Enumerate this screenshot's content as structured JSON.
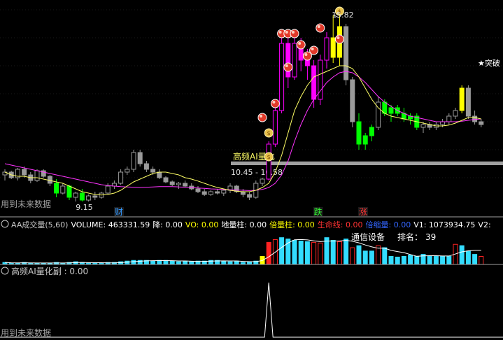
{
  "colors": {
    "bg": "#000000",
    "up": "#ff00ff",
    "down": "#00ff00",
    "neutral": "#9a9a9a",
    "signal": "#ffff00",
    "ma_fast": "#ffff66",
    "ma_slow": "#ff33ff",
    "vol_up": "#ff2222",
    "vol_down": "#33ddff",
    "text": "#c8c8c8",
    "sep": "#a0a0a0"
  },
  "main": {
    "annotation_high": "15.82",
    "annotation_low": "9.15",
    "breakout_label": "★突破",
    "band_title": "高频AI量化",
    "band_range": "10.45 - 10.58",
    "watermark": "用到未来数据",
    "markers": [
      {
        "text": "财",
        "color": "#3399ff"
      },
      {
        "text": "跌",
        "color": "#33ff33"
      },
      {
        "text": "涨",
        "color": "#ff3333"
      }
    ],
    "icons": [
      "money-bag-icon",
      "ball-icon"
    ]
  },
  "vol_panel": {
    "header": [
      {
        "text": "AA成交量(5,60)",
        "color": "#c8c8c8"
      },
      {
        "text": "VOLUME: 463331.59",
        "color": "#ffffff"
      },
      {
        "text": "降: 0.00",
        "color": "#ffffff"
      },
      {
        "text": "VO: 0.00",
        "color": "#ffff00"
      },
      {
        "text": "地量柱: 0.00",
        "color": "#ffffff"
      },
      {
        "text": "倍量柱: 0.00",
        "color": "#ffff00"
      },
      {
        "text": "生命线: 0.00",
        "color": "#ff3333"
      },
      {
        "text": "倍缩量: 0.00",
        "color": "#3366ff"
      },
      {
        "text": "V1: 1073934.75",
        "color": "#ffffff"
      },
      {
        "text": "V2:",
        "color": "#ffffff"
      }
    ],
    "sector": "通信设备",
    "rank_label": "排名：",
    "rank": "39"
  },
  "ai_panel": {
    "header": "高频AI量化副 : 0.00",
    "watermark": "用到未来数据"
  },
  "chart_data": {
    "type": "candlestick",
    "ylim": [
      8.8,
      16.2
    ],
    "band": [
      10.45,
      10.58
    ],
    "high_marker": 15.82,
    "low_marker": 9.15,
    "candles": [
      {
        "o": 10.1,
        "h": 10.3,
        "l": 9.9,
        "c": 10.2,
        "t": "n"
      },
      {
        "o": 10.2,
        "h": 10.25,
        "l": 9.95,
        "c": 10.0,
        "t": "n"
      },
      {
        "o": 10.0,
        "h": 10.35,
        "l": 9.9,
        "c": 10.3,
        "t": "n"
      },
      {
        "o": 10.3,
        "h": 10.4,
        "l": 10.0,
        "c": 10.1,
        "t": "n"
      },
      {
        "o": 10.1,
        "h": 10.2,
        "l": 9.8,
        "c": 9.9,
        "t": "n"
      },
      {
        "o": 9.9,
        "h": 10.3,
        "l": 9.85,
        "c": 10.25,
        "t": "n"
      },
      {
        "o": 10.25,
        "h": 10.3,
        "l": 10.0,
        "c": 10.05,
        "t": "n"
      },
      {
        "o": 10.05,
        "h": 10.1,
        "l": 9.7,
        "c": 9.8,
        "t": "n"
      },
      {
        "o": 9.8,
        "h": 9.95,
        "l": 9.3,
        "c": 9.45,
        "t": "d"
      },
      {
        "o": 9.45,
        "h": 9.8,
        "l": 9.4,
        "c": 9.7,
        "t": "n"
      },
      {
        "o": 9.7,
        "h": 9.75,
        "l": 9.2,
        "c": 9.3,
        "t": "d"
      },
      {
        "o": 9.3,
        "h": 9.5,
        "l": 9.15,
        "c": 9.45,
        "t": "n"
      },
      {
        "o": 9.45,
        "h": 9.6,
        "l": 9.15,
        "c": 9.2,
        "t": "d"
      },
      {
        "o": 9.2,
        "h": 9.4,
        "l": 9.15,
        "c": 9.35,
        "t": "n"
      },
      {
        "o": 9.35,
        "h": 9.5,
        "l": 9.2,
        "c": 9.3,
        "t": "n"
      },
      {
        "o": 9.3,
        "h": 9.5,
        "l": 9.25,
        "c": 9.45,
        "t": "n"
      },
      {
        "o": 9.45,
        "h": 9.8,
        "l": 9.4,
        "c": 9.7,
        "t": "n"
      },
      {
        "o": 9.7,
        "h": 9.9,
        "l": 9.6,
        "c": 9.8,
        "t": "n"
      },
      {
        "o": 9.8,
        "h": 10.3,
        "l": 9.75,
        "c": 10.2,
        "t": "n"
      },
      {
        "o": 10.2,
        "h": 10.4,
        "l": 10.1,
        "c": 10.3,
        "t": "n"
      },
      {
        "o": 10.3,
        "h": 11.0,
        "l": 10.2,
        "c": 10.9,
        "t": "n"
      },
      {
        "o": 10.9,
        "h": 11.0,
        "l": 10.4,
        "c": 10.5,
        "t": "n"
      },
      {
        "o": 10.5,
        "h": 10.6,
        "l": 10.2,
        "c": 10.3,
        "t": "n"
      },
      {
        "o": 10.3,
        "h": 10.4,
        "l": 10.1,
        "c": 10.2,
        "t": "n"
      },
      {
        "o": 10.2,
        "h": 10.3,
        "l": 9.95,
        "c": 10.0,
        "t": "n"
      },
      {
        "o": 10.0,
        "h": 10.05,
        "l": 9.8,
        "c": 9.85,
        "t": "n"
      },
      {
        "o": 9.85,
        "h": 9.9,
        "l": 9.7,
        "c": 9.75,
        "t": "n"
      },
      {
        "o": 9.75,
        "h": 9.85,
        "l": 9.6,
        "c": 9.8,
        "t": "n"
      },
      {
        "o": 9.8,
        "h": 9.9,
        "l": 9.65,
        "c": 9.7,
        "t": "n"
      },
      {
        "o": 9.7,
        "h": 9.8,
        "l": 9.55,
        "c": 9.6,
        "t": "n"
      },
      {
        "o": 9.6,
        "h": 9.7,
        "l": 9.45,
        "c": 9.5,
        "t": "n"
      },
      {
        "o": 9.5,
        "h": 9.6,
        "l": 9.35,
        "c": 9.4,
        "t": "n"
      },
      {
        "o": 9.4,
        "h": 9.55,
        "l": 9.35,
        "c": 9.5,
        "t": "n"
      },
      {
        "o": 9.5,
        "h": 9.6,
        "l": 9.4,
        "c": 9.45,
        "t": "n"
      },
      {
        "o": 9.45,
        "h": 9.6,
        "l": 9.35,
        "c": 9.55,
        "t": "n"
      },
      {
        "o": 9.55,
        "h": 9.8,
        "l": 9.45,
        "c": 9.7,
        "t": "n"
      },
      {
        "o": 9.7,
        "h": 9.75,
        "l": 9.45,
        "c": 9.5,
        "t": "n"
      },
      {
        "o": 9.5,
        "h": 9.6,
        "l": 9.3,
        "c": 9.4,
        "t": "n"
      },
      {
        "o": 9.4,
        "h": 9.5,
        "l": 9.2,
        "c": 9.3,
        "t": "n"
      },
      {
        "o": 9.3,
        "h": 9.9,
        "l": 9.25,
        "c": 9.8,
        "t": "n"
      },
      {
        "o": 9.8,
        "h": 10.0,
        "l": 9.7,
        "c": 9.95,
        "t": "n"
      },
      {
        "o": 9.95,
        "h": 11.3,
        "l": 9.9,
        "c": 11.2,
        "t": "u"
      },
      {
        "o": 11.2,
        "h": 12.5,
        "l": 11.1,
        "c": 12.4,
        "t": "u"
      },
      {
        "o": 12.4,
        "h": 15.0,
        "l": 12.3,
        "c": 14.8,
        "t": "u"
      },
      {
        "o": 14.8,
        "h": 15.0,
        "l": 13.2,
        "c": 13.6,
        "t": "u"
      },
      {
        "o": 13.6,
        "h": 15.0,
        "l": 13.5,
        "c": 14.8,
        "t": "u"
      },
      {
        "o": 14.8,
        "h": 15.0,
        "l": 13.8,
        "c": 14.2,
        "t": "u"
      },
      {
        "o": 14.2,
        "h": 14.6,
        "l": 13.5,
        "c": 14.0,
        "t": "u"
      },
      {
        "o": 14.0,
        "h": 14.2,
        "l": 12.5,
        "c": 12.8,
        "t": "u"
      },
      {
        "o": 12.8,
        "h": 14.4,
        "l": 12.6,
        "c": 14.2,
        "t": "u"
      },
      {
        "o": 14.2,
        "h": 15.2,
        "l": 13.9,
        "c": 15.0,
        "t": "u"
      },
      {
        "o": 15.0,
        "h": 15.8,
        "l": 14.1,
        "c": 14.3,
        "t": "s"
      },
      {
        "o": 14.3,
        "h": 15.8,
        "l": 14.0,
        "c": 15.4,
        "t": "s"
      },
      {
        "o": 15.4,
        "h": 15.5,
        "l": 13.3,
        "c": 13.5,
        "t": "n"
      },
      {
        "o": 13.5,
        "h": 13.6,
        "l": 11.8,
        "c": 12.0,
        "t": "n"
      },
      {
        "o": 12.0,
        "h": 12.3,
        "l": 11.0,
        "c": 11.2,
        "t": "d"
      },
      {
        "o": 11.2,
        "h": 11.6,
        "l": 11.0,
        "c": 11.5,
        "t": "d"
      },
      {
        "o": 11.5,
        "h": 11.9,
        "l": 11.3,
        "c": 11.8,
        "t": "d"
      },
      {
        "o": 11.8,
        "h": 12.9,
        "l": 11.7,
        "c": 12.7,
        "t": "n"
      },
      {
        "o": 12.7,
        "h": 12.8,
        "l": 12.2,
        "c": 12.3,
        "t": "d"
      },
      {
        "o": 12.3,
        "h": 12.6,
        "l": 12.0,
        "c": 12.5,
        "t": "d"
      },
      {
        "o": 12.5,
        "h": 12.6,
        "l": 12.2,
        "c": 12.3,
        "t": "d"
      },
      {
        "o": 12.3,
        "h": 12.5,
        "l": 12.0,
        "c": 12.1,
        "t": "d"
      },
      {
        "o": 12.1,
        "h": 12.3,
        "l": 11.9,
        "c": 12.2,
        "t": "d"
      },
      {
        "o": 12.2,
        "h": 12.3,
        "l": 11.7,
        "c": 11.8,
        "t": "d"
      },
      {
        "o": 11.8,
        "h": 12.0,
        "l": 11.6,
        "c": 11.9,
        "t": "n"
      },
      {
        "o": 11.9,
        "h": 12.0,
        "l": 11.7,
        "c": 11.8,
        "t": "n"
      },
      {
        "o": 11.8,
        "h": 12.0,
        "l": 11.7,
        "c": 11.9,
        "t": "n"
      },
      {
        "o": 11.9,
        "h": 12.1,
        "l": 11.8,
        "c": 12.0,
        "t": "n"
      },
      {
        "o": 12.0,
        "h": 12.3,
        "l": 11.9,
        "c": 12.2,
        "t": "n"
      },
      {
        "o": 12.2,
        "h": 12.5,
        "l": 12.1,
        "c": 12.4,
        "t": "n"
      },
      {
        "o": 12.4,
        "h": 13.3,
        "l": 12.3,
        "c": 13.2,
        "t": "s"
      },
      {
        "o": 13.2,
        "h": 13.3,
        "l": 12.1,
        "c": 12.2,
        "t": "n"
      },
      {
        "o": 12.2,
        "h": 12.4,
        "l": 11.9,
        "c": 12.0,
        "t": "n"
      },
      {
        "o": 12.0,
        "h": 12.1,
        "l": 11.8,
        "c": 11.9,
        "t": "n"
      }
    ],
    "ma_fast": [
      10.2,
      10.1,
      10.05,
      10.05,
      10.0,
      10.0,
      9.95,
      9.9,
      9.85,
      9.8,
      9.7,
      9.6,
      9.5,
      9.45,
      9.4,
      9.38,
      9.4,
      9.45,
      9.55,
      9.7,
      9.85,
      9.95,
      10.05,
      10.15,
      10.2,
      10.2,
      10.15,
      10.1,
      10.0,
      9.95,
      9.88,
      9.8,
      9.72,
      9.65,
      9.6,
      9.55,
      9.52,
      9.5,
      9.5,
      9.55,
      9.65,
      9.8,
      10.2,
      10.8,
      11.6,
      12.4,
      12.9,
      13.3,
      13.6,
      13.7,
      13.8,
      13.9,
      14.0,
      14.0,
      13.9,
      13.6,
      13.2,
      12.8,
      12.5,
      12.3,
      12.2,
      12.15,
      12.1,
      12.05,
      12.0,
      11.95,
      11.9,
      11.85,
      11.85,
      11.88,
      11.95,
      12.05,
      12.15,
      12.15,
      12.1
    ],
    "ma_slow": [
      10.5,
      10.45,
      10.4,
      10.35,
      10.3,
      10.25,
      10.2,
      10.15,
      10.1,
      10.05,
      10.0,
      9.95,
      9.9,
      9.85,
      9.8,
      9.75,
      9.72,
      9.7,
      9.68,
      9.67,
      9.66,
      9.65,
      9.66,
      9.67,
      9.68,
      9.68,
      9.68,
      9.67,
      9.66,
      9.65,
      9.63,
      9.62,
      9.6,
      9.59,
      9.58,
      9.57,
      9.56,
      9.55,
      9.54,
      9.55,
      9.58,
      9.65,
      9.8,
      10.1,
      10.6,
      11.3,
      11.9,
      12.4,
      12.8,
      13.1,
      13.4,
      13.6,
      13.75,
      13.8,
      13.75,
      13.6,
      13.4,
      13.15,
      12.9,
      12.7,
      12.55,
      12.4,
      12.3,
      12.2,
      12.15,
      12.1,
      12.05,
      12.0,
      12.0,
      12.0,
      12.0,
      12.02,
      12.05,
      12.08,
      12.1
    ],
    "volume": {
      "values": [
        3,
        2,
        2,
        3,
        2,
        2,
        2,
        2,
        3,
        2,
        3,
        4,
        3,
        2,
        2,
        2,
        3,
        3,
        4,
        5,
        6,
        6,
        6,
        5,
        6,
        6,
        5,
        4,
        5,
        4,
        5,
        5,
        6,
        6,
        5,
        4,
        5,
        3,
        4,
        5,
        12,
        33,
        37,
        40,
        38,
        36,
        35,
        34,
        33,
        32,
        40,
        36,
        34,
        38,
        25,
        28,
        20,
        20,
        28,
        25,
        12,
        11,
        12,
        14,
        12,
        15,
        12,
        12,
        12,
        12,
        30,
        28,
        20,
        15,
        12
      ],
      "types": [
        "d",
        "d",
        "d",
        "d",
        "d",
        "d",
        "d",
        "d",
        "d",
        "d",
        "d",
        "d",
        "d",
        "d",
        "d",
        "d",
        "d",
        "d",
        "d",
        "d",
        "d",
        "d",
        "d",
        "d",
        "d",
        "d",
        "d",
        "d",
        "d",
        "d",
        "d",
        "d",
        "d",
        "d",
        "d",
        "d",
        "d",
        "d",
        "d",
        "d",
        "s",
        "u",
        "u",
        "d",
        "d",
        "d",
        "d",
        "d",
        "u",
        "u",
        "d",
        "d",
        "u",
        "d",
        "u",
        "d",
        "d",
        "d",
        "u",
        "d",
        "d",
        "d",
        "d",
        "d",
        "d",
        "d",
        "d",
        "d",
        "d",
        "d",
        "u",
        "d",
        "d",
        "d",
        "u"
      ],
      "ylim": [
        0,
        48
      ]
    },
    "ai_signal": {
      "index": 41,
      "value": 1.0,
      "ylim": [
        0,
        1.05
      ]
    }
  }
}
